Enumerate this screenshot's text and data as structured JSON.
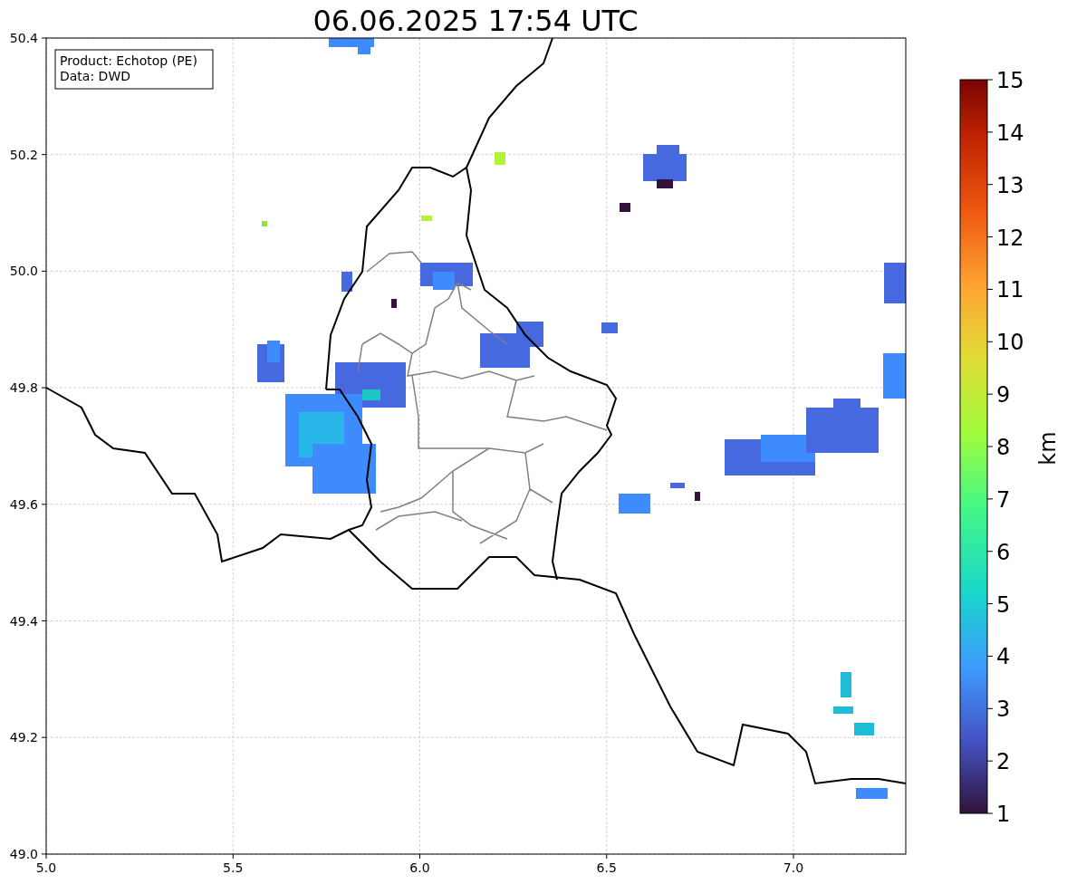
{
  "title": "06.06.2025 17:54 UTC",
  "map": {
    "info_box": [
      "Product: Echotop (PE)",
      "Data: DWD"
    ],
    "xticks": [
      "5.0",
      "5.5",
      "6.0",
      "6.5",
      "7.0"
    ],
    "yticks": [
      "50.4",
      "50.2",
      "50.0",
      "49.8",
      "49.6",
      "49.4",
      "49.2",
      "49.0"
    ]
  },
  "colorbar": {
    "label": "km",
    "ticks": [
      "15",
      "14",
      "13",
      "12",
      "11",
      "10",
      "9",
      "8",
      "7",
      "6",
      "5",
      "4",
      "3",
      "2",
      "1"
    ]
  }
}
